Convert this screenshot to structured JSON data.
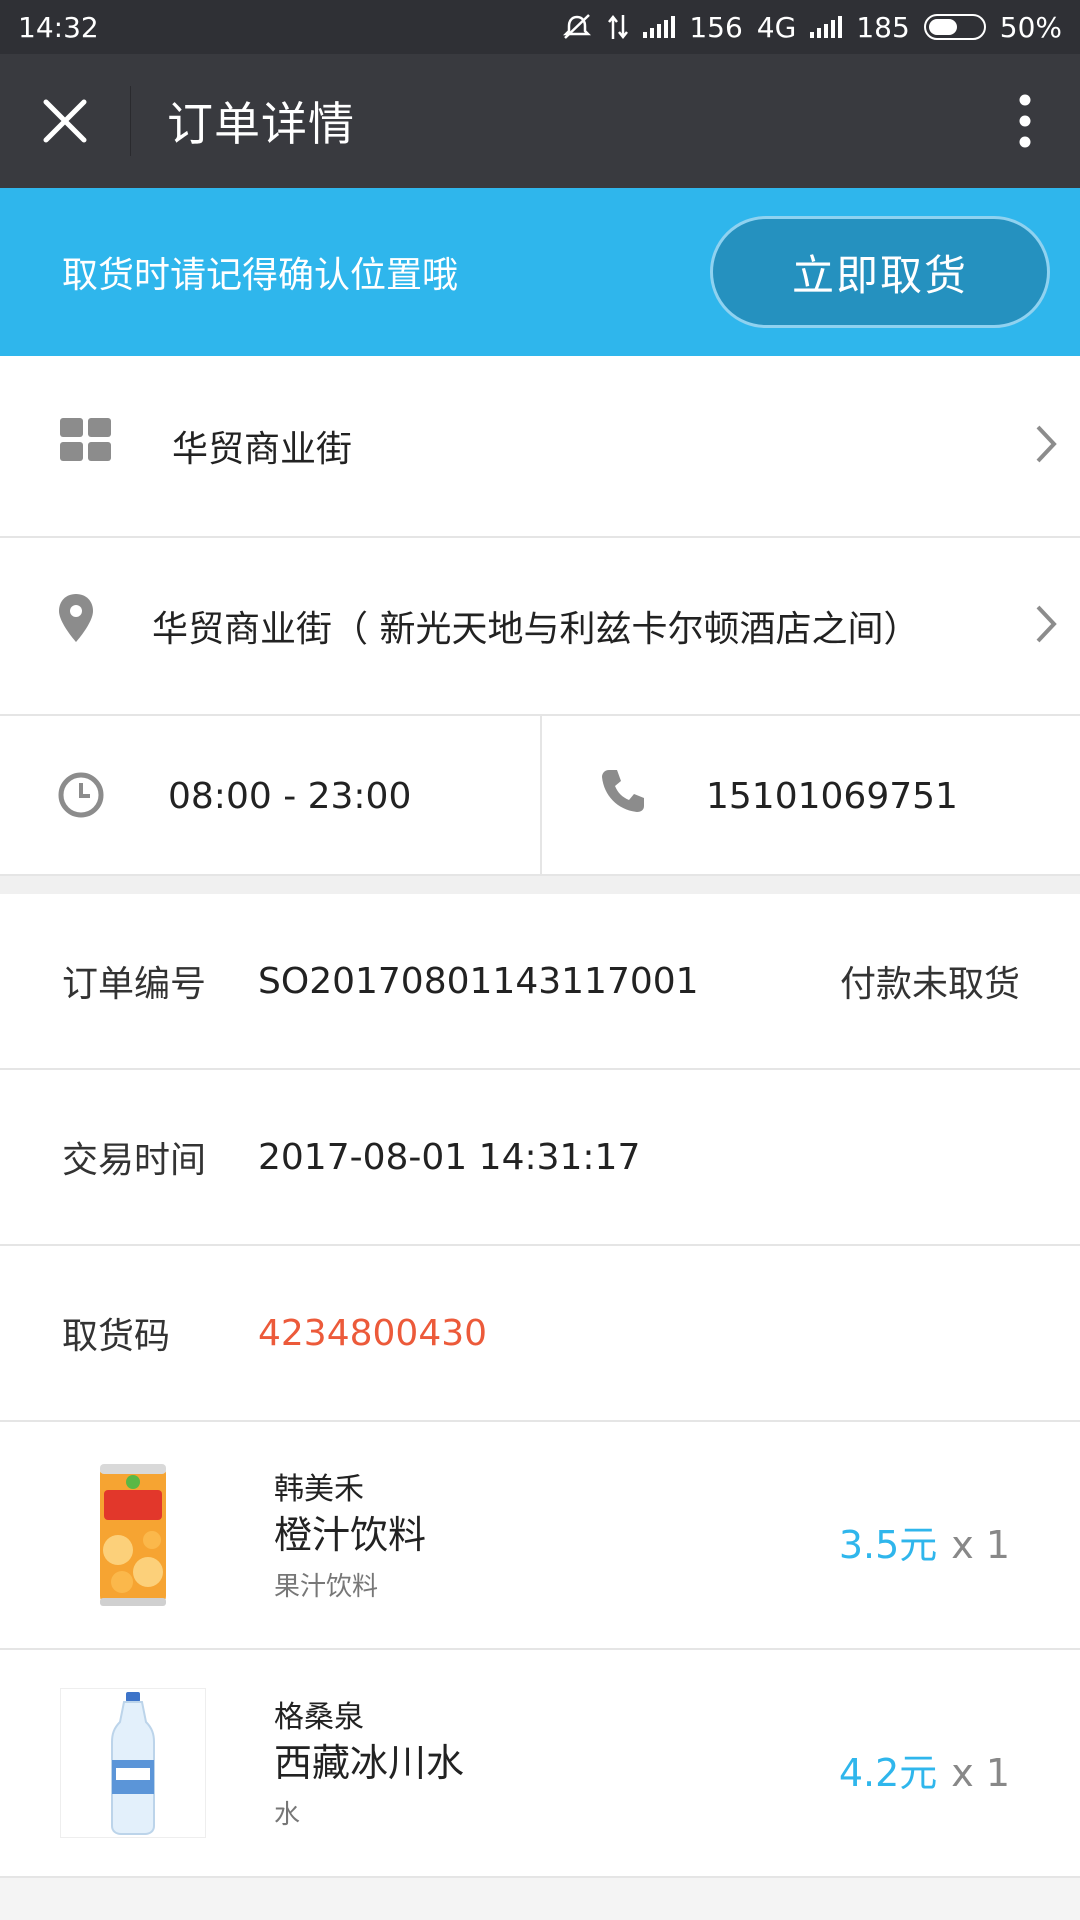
{
  "status_bar": {
    "time": "14:32",
    "net1": "156",
    "net_type": "4G",
    "net2": "185",
    "battery": "50%",
    "battery_level": 0.5
  },
  "header": {
    "title": "订单详情",
    "close_icon": "close-icon",
    "more_icon": "more-vertical-icon"
  },
  "banner": {
    "text": "取货时请记得确认位置哦",
    "button_label": "立即取货",
    "color": "#2fb6ec"
  },
  "store": {
    "name": "华贸商业街",
    "icon": "grid-icon"
  },
  "address": {
    "text": "华贸商业街（ 新光天地与利兹卡尔顿酒店之间）",
    "icon": "location-pin-icon"
  },
  "hours": {
    "text": "08:00 - 23:00",
    "icon": "clock-icon"
  },
  "phone": {
    "text": "15101069751",
    "icon": "phone-icon"
  },
  "order": {
    "number_label": "订单编号",
    "number_value": "SO20170801143117001",
    "status": "付款未取货",
    "time_label": "交易时间",
    "time_value": "2017-08-01 14:31:17",
    "code_label": "取货码",
    "code_value": "4234800430",
    "code_color": "#ec5a3a"
  },
  "products": [
    {
      "brand": "韩美禾",
      "name": "橙汁饮料",
      "category": "果汁饮料",
      "price": "3.5元",
      "qty": "x 1"
    },
    {
      "brand": "格桑泉",
      "name": "西藏冰川水",
      "category": "水",
      "price": "4.2元",
      "qty": "x 1"
    }
  ]
}
